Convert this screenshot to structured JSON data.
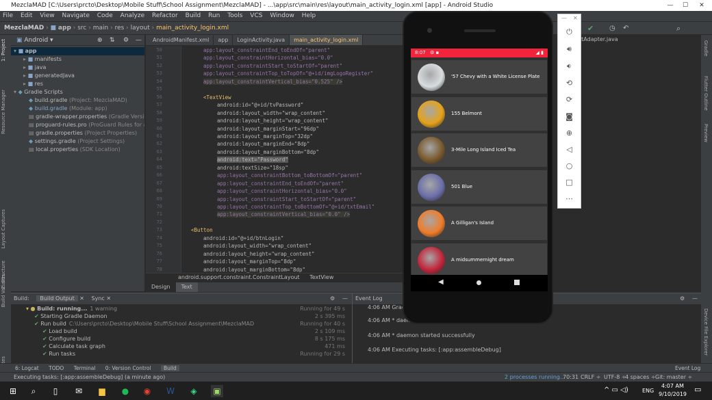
{
  "window": {
    "title": "MezclaMAD [C:\\Users\\prcto\\Desktop\\Mobile Stuff\\School Assignment\\MezclaMAD] - ...\\app\\src\\main\\res\\layout\\main_activity_login.xml [app] - Android Studio",
    "minimize": "—",
    "maximize": "☐",
    "close": "✕"
  },
  "menu": [
    "File",
    "Edit",
    "View",
    "Navigate",
    "Code",
    "Analyze",
    "Refactor",
    "Build",
    "Run",
    "Tools",
    "VCS",
    "Window",
    "Help"
  ],
  "breadcrumb": [
    "MezclaMAD",
    "app",
    "src",
    "main",
    "res",
    "layout",
    "main_activity_login.xml"
  ],
  "project": {
    "view": "Android",
    "tree": [
      {
        "label": "app",
        "indent": 0,
        "bold": true
      },
      {
        "label": "manifests",
        "indent": 1
      },
      {
        "label": "java",
        "indent": 1
      },
      {
        "label": "generatedJava",
        "indent": 1
      },
      {
        "label": "res",
        "indent": 1
      },
      {
        "label": "Gradle Scripts",
        "indent": 0
      },
      {
        "label": "build.gradle",
        "hint": "(Project: MezclaMAD)",
        "indent": 1
      },
      {
        "label": "build.gradle",
        "hint": "(Module: app)",
        "indent": 1
      },
      {
        "label": "gradle-wrapper.properties",
        "hint": "(Gradle Version)",
        "indent": 1
      },
      {
        "label": "proguard-rules.pro",
        "hint": "(ProGuard Rules for app)",
        "indent": 1
      },
      {
        "label": "gradle.properties",
        "hint": "(Project Properties)",
        "indent": 1
      },
      {
        "label": "settings.gradle",
        "hint": "(Project Settings)",
        "indent": 1
      },
      {
        "label": "local.properties",
        "hint": "(SDK Location)",
        "indent": 1
      }
    ]
  },
  "editor_tabs": [
    "AndroidManifest.xml",
    "app",
    "LoginActivity.java",
    "main_activity_login.xml",
    "stAdapter.java"
  ],
  "code": {
    "lines": [
      {
        "n": "50",
        "text": "app:layout_constraintEnd_toEndOf=\"parent\""
      },
      {
        "n": "51",
        "text": "app:layout_constraintHorizontal_bias=\"0.0\""
      },
      {
        "n": "52",
        "text": "app:layout_constraintStart_toStartOf=\"parent\""
      },
      {
        "n": "53",
        "text": "app:layout_constraintTop_toTopOf=\"@+id/imgLogoRegister\""
      },
      {
        "n": "54",
        "text": "app:layout_constraintVertical_bias=\"0.525\" />"
      },
      {
        "n": "55",
        "text": ""
      },
      {
        "n": "56",
        "text": "<TextView"
      },
      {
        "n": "57",
        "text": "android:id=\"@+id/tvPassword\""
      },
      {
        "n": "58",
        "text": "android:layout_width=\"wrap_content\""
      },
      {
        "n": "59",
        "text": "android:layout_height=\"wrap_content\""
      },
      {
        "n": "60",
        "text": "android:layout_marginStart=\"96dp\""
      },
      {
        "n": "61",
        "text": "android:layout_marginTop=\"32dp\""
      },
      {
        "n": "62",
        "text": "android:layout_marginEnd=\"8dp\""
      },
      {
        "n": "63",
        "text": "android:layout_marginBottom=\"8dp\""
      },
      {
        "n": "64",
        "text": "android:text=\"Password\""
      },
      {
        "n": "65",
        "text": "android:textSize=\"18sp\""
      },
      {
        "n": "66",
        "text": "app:layout_constraintBottom_toBottomOf=\"parent\""
      },
      {
        "n": "67",
        "text": "app:layout_constraintEnd_toEndOf=\"parent\""
      },
      {
        "n": "68",
        "text": "app:layout_constraintHorizontal_bias=\"0.0\""
      },
      {
        "n": "69",
        "text": "app:layout_constraintStart_toStartOf=\"parent\""
      },
      {
        "n": "70",
        "text": "app:layout_constraintTop_toBottomOf=\"@+id/txtEmail\""
      },
      {
        "n": "71",
        "text": "app:layout_constraintVertical_bias=\"0.0\" />"
      },
      {
        "n": "72",
        "text": ""
      },
      {
        "n": "73",
        "text": "<Button"
      },
      {
        "n": "74",
        "text": "android:id=\"@+id/btnLogin\""
      },
      {
        "n": "75",
        "text": "android:layout_width=\"wrap_content\""
      },
      {
        "n": "76",
        "text": "android:layout_height=\"wrap_content\""
      },
      {
        "n": "77",
        "text": "android:layout_marginTop=\"8dp\""
      },
      {
        "n": "78",
        "text": "android:layout_marginBottom=\"8dp\""
      }
    ],
    "crumb": [
      "android.support.constraint.ConstraintLayout",
      "TextView"
    ]
  },
  "design_tabs": [
    "Design",
    "Text"
  ],
  "build": {
    "tabs": [
      "Build:",
      "Build Output",
      "Sync"
    ],
    "rows": [
      {
        "label": "Build: running...",
        "extra": "1 warning",
        "time": "Running for 49 s",
        "indent": 0
      },
      {
        "label": "Starting Gradle Daemon",
        "time": "2 s 395 ms",
        "indent": 1
      },
      {
        "label": "Run build",
        "extra": "C:\\Users\\prcto\\Desktop\\Mobile Stuff\\School Assignment\\MezclaMAD",
        "time": "Running for 40 s",
        "indent": 1
      },
      {
        "label": "Load build",
        "time": "2 s 109 ms",
        "indent": 2
      },
      {
        "label": "Configure build",
        "time": "8 s 175 ms",
        "indent": 2
      },
      {
        "label": "Calculate task graph",
        "time": "471 ms",
        "indent": 2
      },
      {
        "label": "Run tasks",
        "time": "Running for 29 s",
        "indent": 2
      }
    ]
  },
  "event_log": {
    "title": "Event Log",
    "rows": [
      "4:06 AM Gradle",
      "4:06 AM * daemon",
      "4:06 AM * daemon started successfully",
      "4:06 AM Executing tasks: [:app:assembleDebug]"
    ]
  },
  "bottom_tabs": [
    "6: Logcat",
    "TODO",
    "Terminal",
    "0: Version Control",
    "Build",
    "Event Log"
  ],
  "status": {
    "left": "Executing tasks: [:app:assembleDebug] (a minute ago)",
    "right": [
      "2 processes running...",
      "70:31",
      "CRLF ÷",
      "UTF-8 ÷",
      "4 spaces ÷",
      "Git: master ÷"
    ]
  },
  "taskbar": {
    "time": "4:07 AM",
    "date": "9/10/2019",
    "lang": "ENG"
  },
  "phone": {
    "status_time": "8:07",
    "items": [
      {
        "name": "'57 Chevy with a White License Plate",
        "color": "#d8dde0"
      },
      {
        "name": "155 Belmont",
        "color": "#e5a21a"
      },
      {
        "name": "3-Mile Long Island Iced Tea",
        "color": "#7a5a2e"
      },
      {
        "name": "501 Blue",
        "color": "#6b6ea8"
      },
      {
        "name": "A Gilligan's Island",
        "color": "#ef7c2a"
      },
      {
        "name": "A midsummernight dream",
        "color": "#c2253a"
      }
    ]
  },
  "accent": "#f2243b"
}
